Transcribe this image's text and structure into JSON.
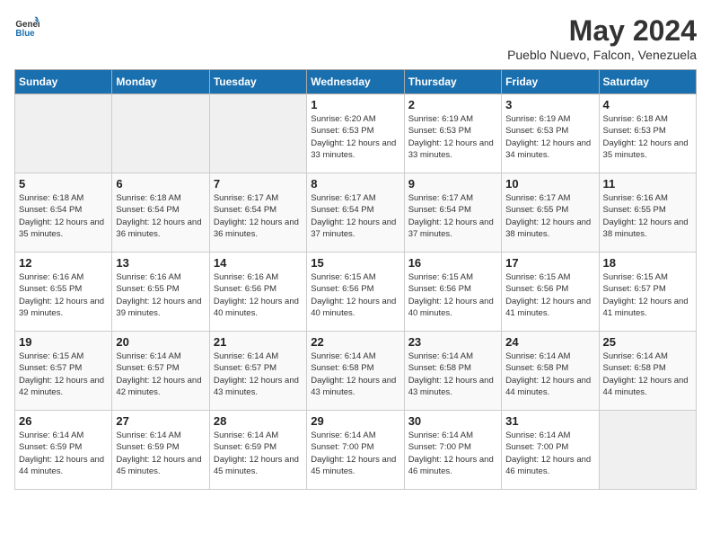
{
  "header": {
    "logo_general": "General",
    "logo_blue": "Blue",
    "title": "May 2024",
    "location": "Pueblo Nuevo, Falcon, Venezuela"
  },
  "days_of_week": [
    "Sunday",
    "Monday",
    "Tuesday",
    "Wednesday",
    "Thursday",
    "Friday",
    "Saturday"
  ],
  "weeks": [
    [
      {
        "day": "",
        "info": ""
      },
      {
        "day": "",
        "info": ""
      },
      {
        "day": "",
        "info": ""
      },
      {
        "day": "1",
        "info": "Sunrise: 6:20 AM\nSunset: 6:53 PM\nDaylight: 12 hours and 33 minutes."
      },
      {
        "day": "2",
        "info": "Sunrise: 6:19 AM\nSunset: 6:53 PM\nDaylight: 12 hours and 33 minutes."
      },
      {
        "day": "3",
        "info": "Sunrise: 6:19 AM\nSunset: 6:53 PM\nDaylight: 12 hours and 34 minutes."
      },
      {
        "day": "4",
        "info": "Sunrise: 6:18 AM\nSunset: 6:53 PM\nDaylight: 12 hours and 35 minutes."
      }
    ],
    [
      {
        "day": "5",
        "info": "Sunrise: 6:18 AM\nSunset: 6:54 PM\nDaylight: 12 hours and 35 minutes."
      },
      {
        "day": "6",
        "info": "Sunrise: 6:18 AM\nSunset: 6:54 PM\nDaylight: 12 hours and 36 minutes."
      },
      {
        "day": "7",
        "info": "Sunrise: 6:17 AM\nSunset: 6:54 PM\nDaylight: 12 hours and 36 minutes."
      },
      {
        "day": "8",
        "info": "Sunrise: 6:17 AM\nSunset: 6:54 PM\nDaylight: 12 hours and 37 minutes."
      },
      {
        "day": "9",
        "info": "Sunrise: 6:17 AM\nSunset: 6:54 PM\nDaylight: 12 hours and 37 minutes."
      },
      {
        "day": "10",
        "info": "Sunrise: 6:17 AM\nSunset: 6:55 PM\nDaylight: 12 hours and 38 minutes."
      },
      {
        "day": "11",
        "info": "Sunrise: 6:16 AM\nSunset: 6:55 PM\nDaylight: 12 hours and 38 minutes."
      }
    ],
    [
      {
        "day": "12",
        "info": "Sunrise: 6:16 AM\nSunset: 6:55 PM\nDaylight: 12 hours and 39 minutes."
      },
      {
        "day": "13",
        "info": "Sunrise: 6:16 AM\nSunset: 6:55 PM\nDaylight: 12 hours and 39 minutes."
      },
      {
        "day": "14",
        "info": "Sunrise: 6:16 AM\nSunset: 6:56 PM\nDaylight: 12 hours and 40 minutes."
      },
      {
        "day": "15",
        "info": "Sunrise: 6:15 AM\nSunset: 6:56 PM\nDaylight: 12 hours and 40 minutes."
      },
      {
        "day": "16",
        "info": "Sunrise: 6:15 AM\nSunset: 6:56 PM\nDaylight: 12 hours and 40 minutes."
      },
      {
        "day": "17",
        "info": "Sunrise: 6:15 AM\nSunset: 6:56 PM\nDaylight: 12 hours and 41 minutes."
      },
      {
        "day": "18",
        "info": "Sunrise: 6:15 AM\nSunset: 6:57 PM\nDaylight: 12 hours and 41 minutes."
      }
    ],
    [
      {
        "day": "19",
        "info": "Sunrise: 6:15 AM\nSunset: 6:57 PM\nDaylight: 12 hours and 42 minutes."
      },
      {
        "day": "20",
        "info": "Sunrise: 6:14 AM\nSunset: 6:57 PM\nDaylight: 12 hours and 42 minutes."
      },
      {
        "day": "21",
        "info": "Sunrise: 6:14 AM\nSunset: 6:57 PM\nDaylight: 12 hours and 43 minutes."
      },
      {
        "day": "22",
        "info": "Sunrise: 6:14 AM\nSunset: 6:58 PM\nDaylight: 12 hours and 43 minutes."
      },
      {
        "day": "23",
        "info": "Sunrise: 6:14 AM\nSunset: 6:58 PM\nDaylight: 12 hours and 43 minutes."
      },
      {
        "day": "24",
        "info": "Sunrise: 6:14 AM\nSunset: 6:58 PM\nDaylight: 12 hours and 44 minutes."
      },
      {
        "day": "25",
        "info": "Sunrise: 6:14 AM\nSunset: 6:58 PM\nDaylight: 12 hours and 44 minutes."
      }
    ],
    [
      {
        "day": "26",
        "info": "Sunrise: 6:14 AM\nSunset: 6:59 PM\nDaylight: 12 hours and 44 minutes."
      },
      {
        "day": "27",
        "info": "Sunrise: 6:14 AM\nSunset: 6:59 PM\nDaylight: 12 hours and 45 minutes."
      },
      {
        "day": "28",
        "info": "Sunrise: 6:14 AM\nSunset: 6:59 PM\nDaylight: 12 hours and 45 minutes."
      },
      {
        "day": "29",
        "info": "Sunrise: 6:14 AM\nSunset: 7:00 PM\nDaylight: 12 hours and 45 minutes."
      },
      {
        "day": "30",
        "info": "Sunrise: 6:14 AM\nSunset: 7:00 PM\nDaylight: 12 hours and 46 minutes."
      },
      {
        "day": "31",
        "info": "Sunrise: 6:14 AM\nSunset: 7:00 PM\nDaylight: 12 hours and 46 minutes."
      },
      {
        "day": "",
        "info": ""
      }
    ]
  ]
}
